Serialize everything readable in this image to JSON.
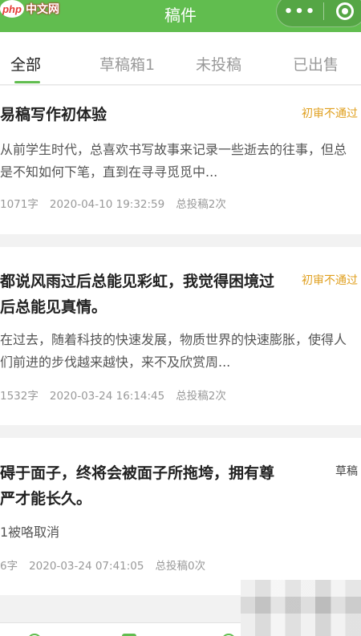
{
  "header": {
    "title": "稿件",
    "watermark_logo": "php",
    "watermark_text": "中文网",
    "more_label": "•••",
    "close_icon": "target-circle-icon"
  },
  "tabs": [
    {
      "label": "全部",
      "active": true
    },
    {
      "label": "草稿箱1",
      "active": false
    },
    {
      "label": "未投稿",
      "active": false
    },
    {
      "label": "已出售",
      "active": false
    }
  ],
  "articles": [
    {
      "title": "易稿写作初体验",
      "status": "初审不通过",
      "excerpt": "从前学生时代，总喜欢书写故事来记录一些逝去的往事，但总是不知如何下笔，直到在寻寻觅觅中...",
      "words": "1071字",
      "date": "2020-04-10 19:32:59",
      "submissions": "总投稿2次"
    },
    {
      "title": "都说风雨过后总能见彩虹，我觉得困境过后总能见真情。",
      "status": "初审不通过",
      "excerpt": "在过去，随着科技的快速发展，物质世界的快速膨胀，使得人们前进的步伐越来越快，来不及欣赏周...",
      "words": "1532字",
      "date": "2020-03-24 16:14:45",
      "submissions": "总投稿2次"
    },
    {
      "title": "碍于面子，终将会被面子所拖垮，拥有尊严才能长久。",
      "status": "草稿",
      "excerpt": "1被咯取消",
      "words": "6字",
      "date": "2020-03-24 07:41:05",
      "submissions": "总投稿0次"
    }
  ],
  "colors": {
    "brand": "#61bd4f",
    "status_rejected": "#e0a020",
    "status_draft": "#444444"
  }
}
